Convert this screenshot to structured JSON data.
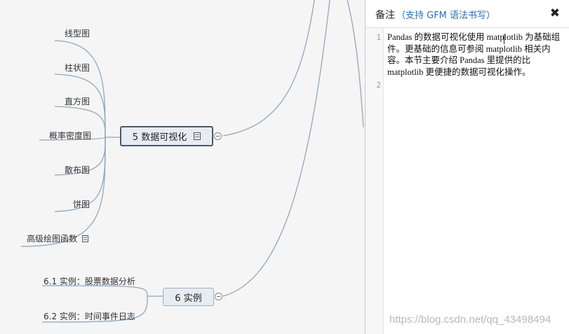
{
  "mindmap": {
    "topic5": {
      "label": "5 数据可视化"
    },
    "topic5_children": [
      "线型图",
      "柱状图",
      "直方图",
      "概率密度图",
      "散布图",
      "饼图",
      "高级绘图函数"
    ],
    "topic6": {
      "label": "6 实例"
    },
    "topic6_children": [
      "6.1 实例：股票数据分析",
      "6.2 实例：时间事件日志"
    ]
  },
  "notes_panel": {
    "title": "备注",
    "hint": "（支持 GFM 语法书写）",
    "close_icon": "✖",
    "line_numbers": [
      "1",
      "2"
    ],
    "content": "Pandas 的数据可视化使用 matplotlib 为基础组件。更基础的信息可参阅 matplotlib 相关内容。本节主要介绍 Pandas 里提供的比 matplotlib 更便捷的数据可视化操作。"
  },
  "watermark": "https://blog.csdn.net/qq_43498494"
}
